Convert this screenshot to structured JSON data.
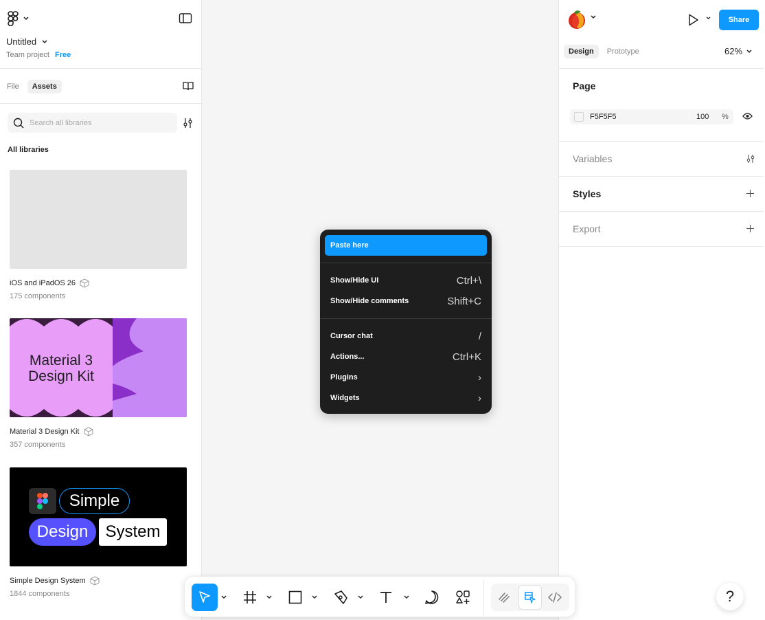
{
  "left_panel": {
    "file_title": "Untitled",
    "team": "Team project",
    "plan_badge": "Free",
    "tabs": [
      {
        "label": "File",
        "active": false
      },
      {
        "label": "Assets",
        "active": true
      }
    ],
    "search_placeholder": "Search all libraries",
    "section_label": "All libraries",
    "libraries": [
      {
        "name": "iOS and iPadOS 26",
        "count": "175 components"
      },
      {
        "name": "Material 3 Design Kit",
        "count": "357 components",
        "thumb_text": [
          "Material 3",
          "Design Kit"
        ]
      },
      {
        "name": "Simple Design System",
        "count": "1844 components",
        "thumb_text": [
          "Simple",
          "Design",
          "System"
        ]
      }
    ]
  },
  "context_menu": {
    "items": [
      {
        "label": "Paste here",
        "shortcut": "",
        "active": true
      },
      {
        "label": "Show/Hide UI",
        "shortcut": "Ctrl+\\"
      },
      {
        "label": "Show/Hide comments",
        "shortcut": "Shift+C"
      },
      {
        "label": "Cursor chat",
        "shortcut": "/"
      },
      {
        "label": "Actions...",
        "shortcut": "Ctrl+K"
      },
      {
        "label": "Plugins",
        "shortcut": "›"
      },
      {
        "label": "Widgets",
        "shortcut": "›"
      }
    ]
  },
  "right_panel": {
    "share_label": "Share",
    "tabs": [
      {
        "label": "Design",
        "active": true
      },
      {
        "label": "Prototype",
        "active": false
      }
    ],
    "zoom": "62%",
    "page_section": "Page",
    "page_color": "F5F5F5",
    "page_opacity": "100",
    "opacity_unit": "%",
    "variables_section": "Variables",
    "styles_section": "Styles",
    "export_section": "Export"
  },
  "toolbar": {
    "tools": [
      "move-tool",
      "frame-tool",
      "rectangle-tool",
      "pen-tool",
      "text-tool",
      "comment-tool",
      "actions-tool"
    ],
    "modes": [
      "draw-mode",
      "design-mode",
      "dev-mode"
    ]
  },
  "help_label": "?",
  "colors": {
    "accent": "#0d99ff",
    "menu_bg": "#1e1e1e",
    "canvas_bg": "#f5f5f5"
  }
}
